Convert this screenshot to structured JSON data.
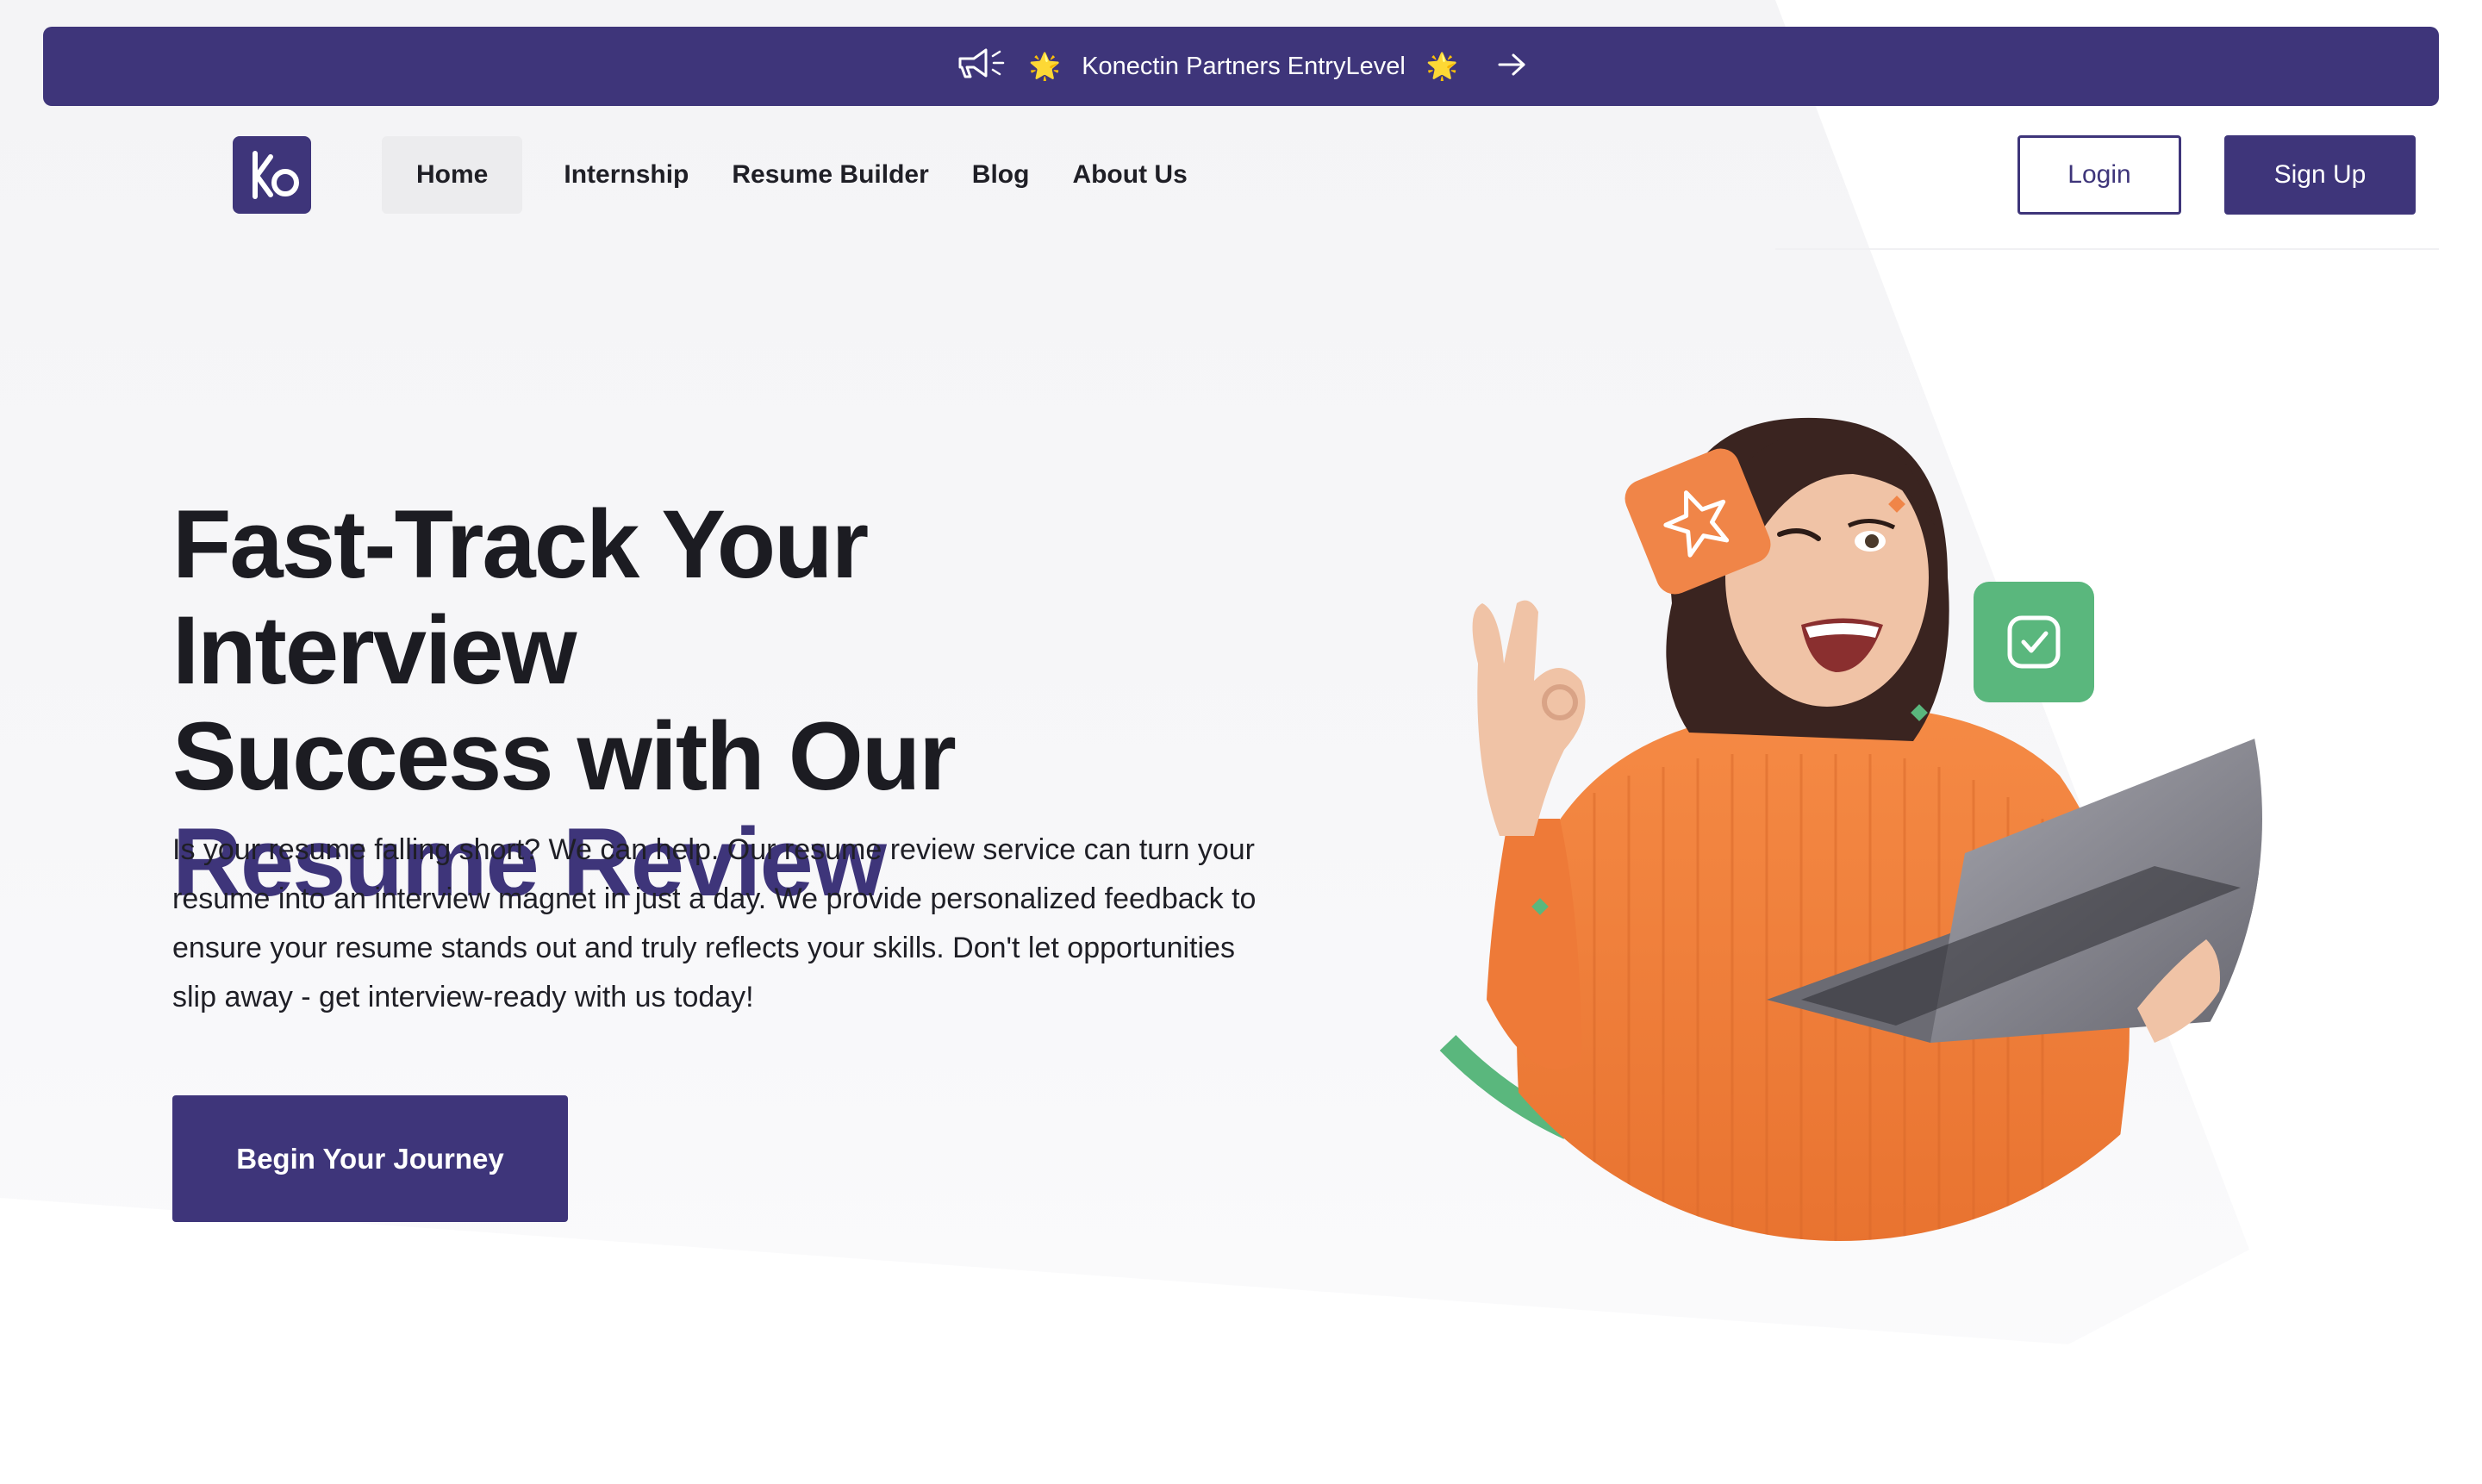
{
  "announcement": {
    "text": "Konectin Partners EntryLevel",
    "icon": "megaphone-icon",
    "sparkle": "🌟",
    "arrow_icon": "arrow-right-icon"
  },
  "header": {
    "logo_text": "ko",
    "nav": [
      {
        "label": "Home",
        "active": true
      },
      {
        "label": "Internship",
        "active": false
      },
      {
        "label": "Resume Builder",
        "active": false
      },
      {
        "label": "Blog",
        "active": false
      },
      {
        "label": "About Us",
        "active": false
      }
    ],
    "login_label": "Login",
    "signup_label": "Sign Up"
  },
  "hero": {
    "title_line1": "Fast-Track Your Interview",
    "title_line2": "Success with Our",
    "title_accent": "Resume Review",
    "description": "Is your resume falling short? We can help. Our resume review service can turn your resume into an interview magnet in just a day. We provide personalized feedback to ensure your resume stands out and truly reflects your skills. Don't let opportunities slip away - get interview-ready with us today!",
    "cta_label": "Begin Your Journey"
  },
  "colors": {
    "brand": "#3e357a",
    "orange": "#f08548",
    "green": "#5ab77d",
    "background": "#f6f6f8"
  },
  "illustration": {
    "badges": [
      "star-badge-icon",
      "check-badge-icon"
    ]
  }
}
